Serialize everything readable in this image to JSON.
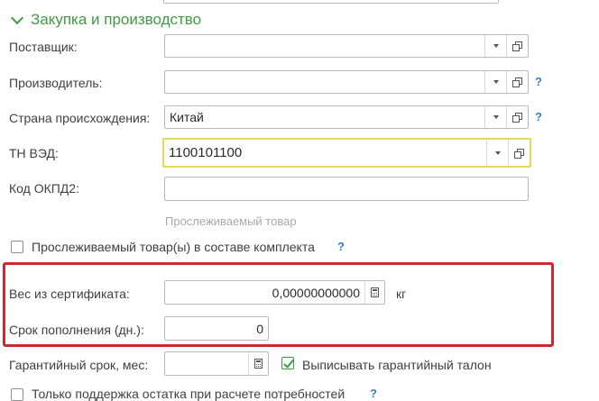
{
  "section": {
    "title": "Закупка и производство"
  },
  "fields": {
    "supplier": {
      "label": "Поставщик:",
      "value": ""
    },
    "manufacturer": {
      "label": "Производитель:",
      "value": ""
    },
    "country": {
      "label": "Страна происхождения:",
      "value": "Китай"
    },
    "tnved": {
      "label": "ТН ВЭД:",
      "value": "1100101100"
    },
    "okpd2": {
      "label": "Код ОКПД2:",
      "value": ""
    },
    "traceable_hint": "Прослеживаемый товар",
    "traceable_kit": {
      "label": "Прослеживаемый товар(ы) в составе комплекта",
      "checked": false
    },
    "cert_weight": {
      "label": "Вес из сертификата:",
      "value": "0,00000000000",
      "unit": "кг"
    },
    "replenish_days": {
      "label": "Срок пополнения (дн.):",
      "value": "0"
    },
    "warranty": {
      "label": "Гарантийный срок, мес:",
      "value": ""
    },
    "warranty_ticket": {
      "label": "Выписывать гарантийный талон",
      "checked": true
    },
    "stock_only": {
      "label": "Только поддержка остатка при расчете потребностей",
      "checked": false
    }
  },
  "help_mark": "?",
  "colors": {
    "accent_green": "#3f9a44",
    "highlight_red": "#cc2b2b",
    "focus_yellow": "#e6d85c",
    "help_blue": "#3a7fc1"
  }
}
